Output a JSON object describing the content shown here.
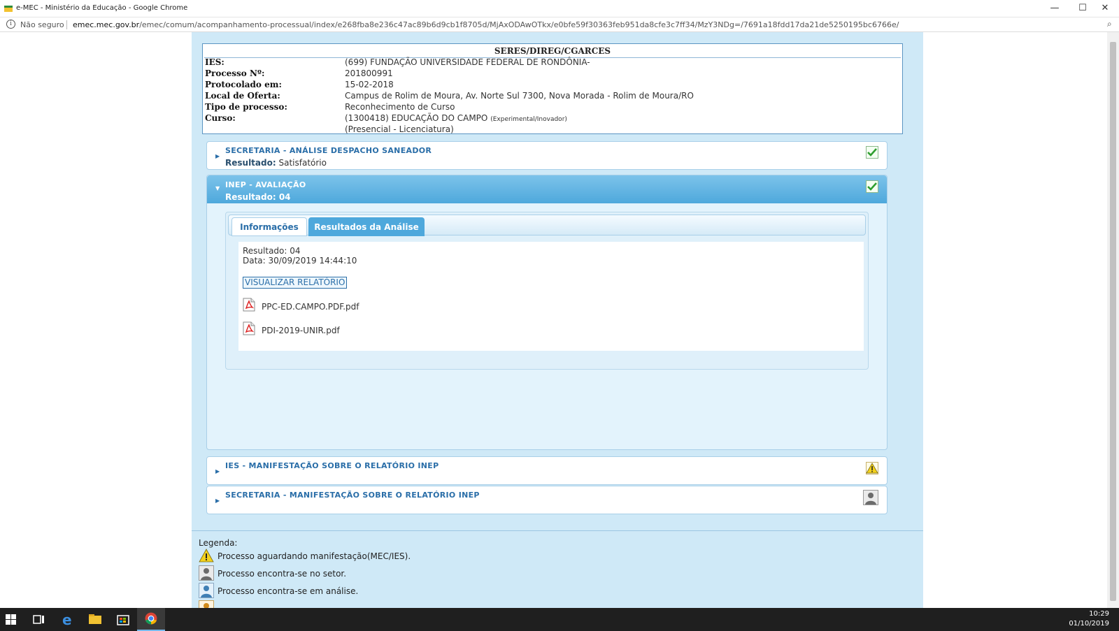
{
  "window": {
    "title": "e-MEC - Ministério da Educação - Google Chrome",
    "min_symbol": "—",
    "max_symbol": "☐",
    "close_symbol": "✕"
  },
  "addressbar": {
    "security_label": "Não seguro",
    "url_domain": "emec.mec.gov.br",
    "url_path": "/emec/comum/acompanhamento-processual/index/e268fba8e236c47ac89b6d9cb1f8705d/MjAxODAwOTkx/e0bfe59f30363feb951da8cfe3c7ff34/MzY3NDg=/7691a18fdd17da21de5250195bc6766e/"
  },
  "process": {
    "box_title": "SERES/DIREG/CGARCES",
    "rows": [
      {
        "label": "IES:",
        "value": "(699) FUNDAÇÃO UNIVERSIDADE FEDERAL DE RONDÔNIA-"
      },
      {
        "label": "Processo Nº:",
        "value": "201800991"
      },
      {
        "label": "Protocolado em:",
        "value": "15-02-2018"
      },
      {
        "label": "Local de Oferta:",
        "value": "Campus de Rolim de Moura, Av. Norte Sul 7300, Nova Morada - Rolim de Moura/RO"
      },
      {
        "label": "Tipo de processo:",
        "value": "Reconhecimento de Curso"
      },
      {
        "label": "Curso:",
        "value": "(1300418) EDUCAÇÃO DO CAMPO",
        "value_small": "(Experimental/Inovador)"
      }
    ],
    "course_mode": "(Presencial - Licenciatura)"
  },
  "sections": {
    "saneador": {
      "title": "SECRETARIA - ANÁLISE DESPACHO SANEADOR",
      "result_label": "Resultado:",
      "result_value": "Satisfatório",
      "status_icon": "check-icon"
    },
    "inep": {
      "title": "INEP - AVALIAÇÃO",
      "result": "Resultado: 04",
      "status_icon": "check-icon",
      "tabs": [
        "Informações",
        "Resultados da Análise"
      ],
      "active_tab": "Resultados da Análise",
      "resultado_line": "Resultado: 04",
      "data_line": "Data: 30/09/2019 14:44:10",
      "report_button": "VISUALIZAR RELATÓRIO",
      "files": [
        "PPC-ED.CAMPO.PDF.pdf",
        "PDI-2019-UNIR.pdf"
      ]
    },
    "ies_manifest": {
      "title": "IES - MANIFESTAÇÃO SOBRE O RELATÓRIO INEP",
      "status_icon": "warning-icon"
    },
    "sec_manifest": {
      "title": "SECRETARIA - MANIFESTAÇÃO SOBRE O RELATÓRIO INEP",
      "status_icon": "person-grey-icon"
    }
  },
  "legend": {
    "title": "Legenda:",
    "items": [
      {
        "icon": "warning-icon",
        "text": "Processo aguardando manifestação(MEC/IES)."
      },
      {
        "icon": "person-grey-icon",
        "text": "Processo encontra-se no setor."
      },
      {
        "icon": "person-blue-icon",
        "text": "Processo encontra-se em análise."
      }
    ]
  },
  "taskbar": {
    "time": "10:29",
    "date": "01/10/2019"
  },
  "colors": {
    "page_bg": "#cfe9f7",
    "accent": "#4ea8dc",
    "title_blue": "#2a6ea8"
  }
}
